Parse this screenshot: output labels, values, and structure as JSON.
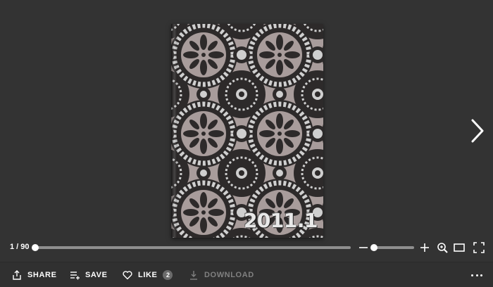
{
  "viewer": {
    "cover_text": "2011.1",
    "page_counter": "1 / 90",
    "page_progress": 0.011,
    "zoom_level": 0.0
  },
  "icons": {
    "next": "chevron-right-icon",
    "zoom_out": "minus-icon",
    "zoom_in": "plus-icon",
    "zoom_tool": "zoom-search-icon",
    "single_page": "single-page-icon",
    "fullscreen": "fullscreen-icon",
    "share": "share-icon",
    "save": "save-list-icon",
    "like": "heart-icon",
    "download": "download-icon",
    "more": "more-dots-icon"
  },
  "actions": {
    "share_label": "SHARE",
    "save_label": "SAVE",
    "like_label": "LIKE",
    "like_count": "2",
    "download_label": "DOWNLOAD"
  },
  "colors": {
    "background": "#333333",
    "action_bar": "#303030",
    "track": "#8f8f8f",
    "disabled_text": "#808080",
    "cover_pattern_light": "#c9c9c9",
    "cover_pattern_mauve": "#a89c9b",
    "cover_pattern_dark": "#2d2a2a"
  }
}
